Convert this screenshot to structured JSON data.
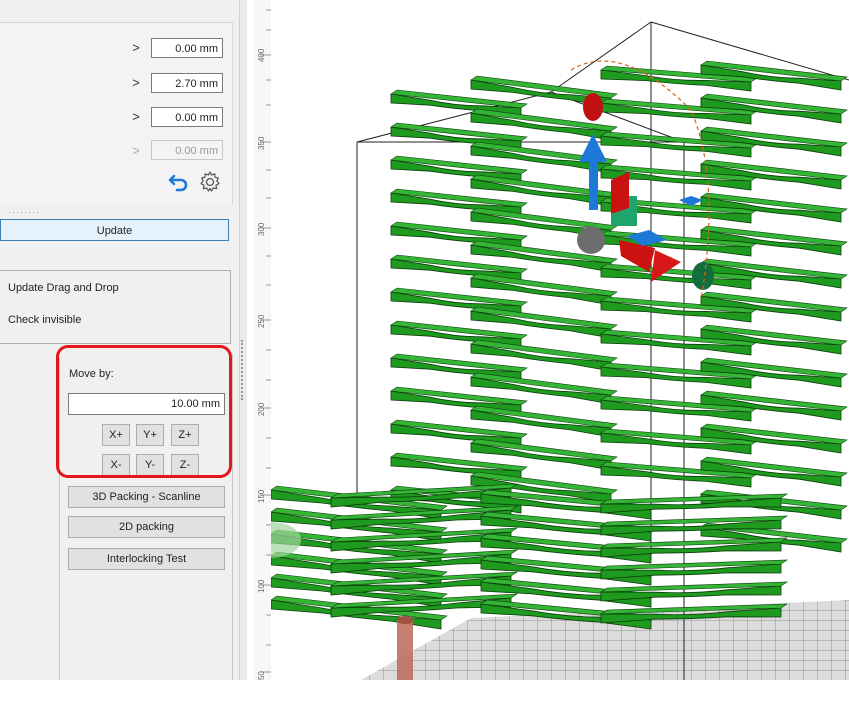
{
  "top_rows": [
    {
      "arrow": ">",
      "value": "0.00 mm",
      "disabled": false
    },
    {
      "arrow": ">",
      "value": "2.70 mm",
      "disabled": false
    },
    {
      "arrow": ">",
      "value": "0.00 mm",
      "disabled": false
    },
    {
      "arrow": ">",
      "value": "0.00 mm",
      "disabled": true
    }
  ],
  "icons": {
    "undo": "undo-arrow-icon",
    "settings": "gear-icon"
  },
  "grip": "········",
  "update_button": "Update",
  "options": {
    "drag_drop": "Update Drag and Drop",
    "check_invisible": "Check invisible"
  },
  "move_by": {
    "label": "Move by:",
    "value": "10.00 mm",
    "buttons_row1": [
      "X+",
      "Y+",
      "Z+"
    ],
    "buttons_row2": [
      "X-",
      "Y-",
      "Z-"
    ]
  },
  "actions": [
    "3D Packing - Scanline",
    "2D packing",
    "Interlocking Test"
  ],
  "ruler_labels": [
    "400",
    "350",
    "300",
    "250",
    "200",
    "150",
    "100",
    "50"
  ],
  "colors": {
    "highlight": "#e3161c",
    "part_green": "#1e9a1e",
    "accent_blue": "#1e78d8"
  }
}
